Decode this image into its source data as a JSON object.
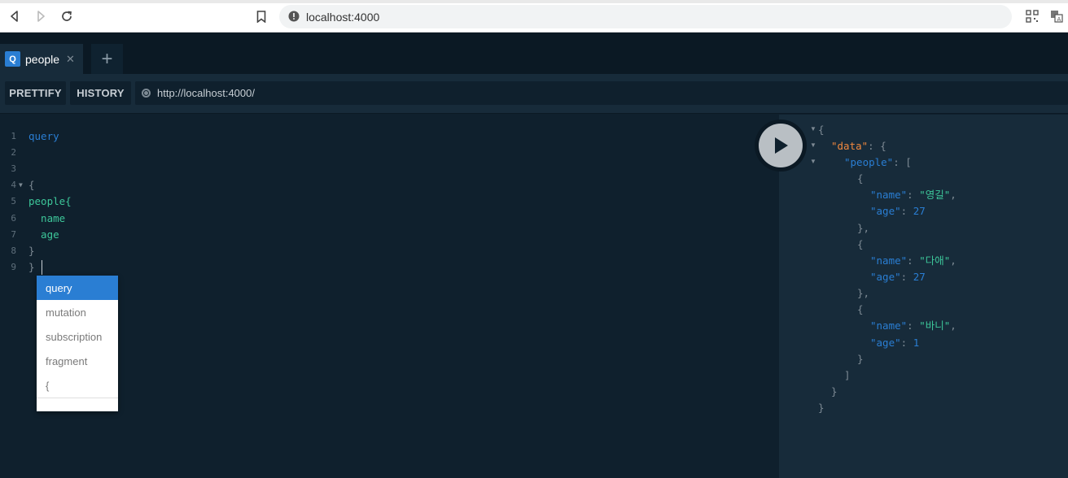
{
  "browser": {
    "url": "localhost:4000"
  },
  "tabs": [
    {
      "badge": "Q",
      "label": "people",
      "close": "✕"
    }
  ],
  "tab_add": "+",
  "toolbar": {
    "prettify_label": "PRETTIFY",
    "history_label": "HISTORY",
    "endpoint": "http://localhost:4000/"
  },
  "editor": {
    "lines": [
      {
        "n": "1",
        "text": "query"
      },
      {
        "n": "2",
        "text": ""
      },
      {
        "n": "3",
        "text": ""
      },
      {
        "n": "4",
        "text": "{"
      },
      {
        "n": "5",
        "text": "people{"
      },
      {
        "n": "6",
        "text": "  name"
      },
      {
        "n": "7",
        "text": "  age"
      },
      {
        "n": "8",
        "text": "}"
      },
      {
        "n": "9",
        "text": "}"
      }
    ]
  },
  "autocomplete": {
    "items": [
      "query",
      "mutation",
      "subscription",
      "fragment",
      "{"
    ]
  },
  "result": {
    "lines": [
      "{",
      "\"data\": {",
      "\"people\": [",
      "{",
      "\"name\": \"영길\",",
      "\"age\": 27",
      "},",
      "{",
      "\"name\": \"다애\",",
      "\"age\": 27",
      "},",
      "{",
      "\"name\": \"바니\",",
      "\"age\": 1",
      "}",
      "]",
      "}",
      "}"
    ],
    "people": [
      {
        "name": "영길",
        "age": 27
      },
      {
        "name": "다애",
        "age": 27
      },
      {
        "name": "바니",
        "age": 1
      }
    ]
  },
  "icons": {
    "back": "back-arrow-icon",
    "forward": "forward-arrow-icon",
    "reload": "reload-icon",
    "bookmark": "bookmark-icon",
    "info": "info-icon",
    "play": "play-icon"
  }
}
